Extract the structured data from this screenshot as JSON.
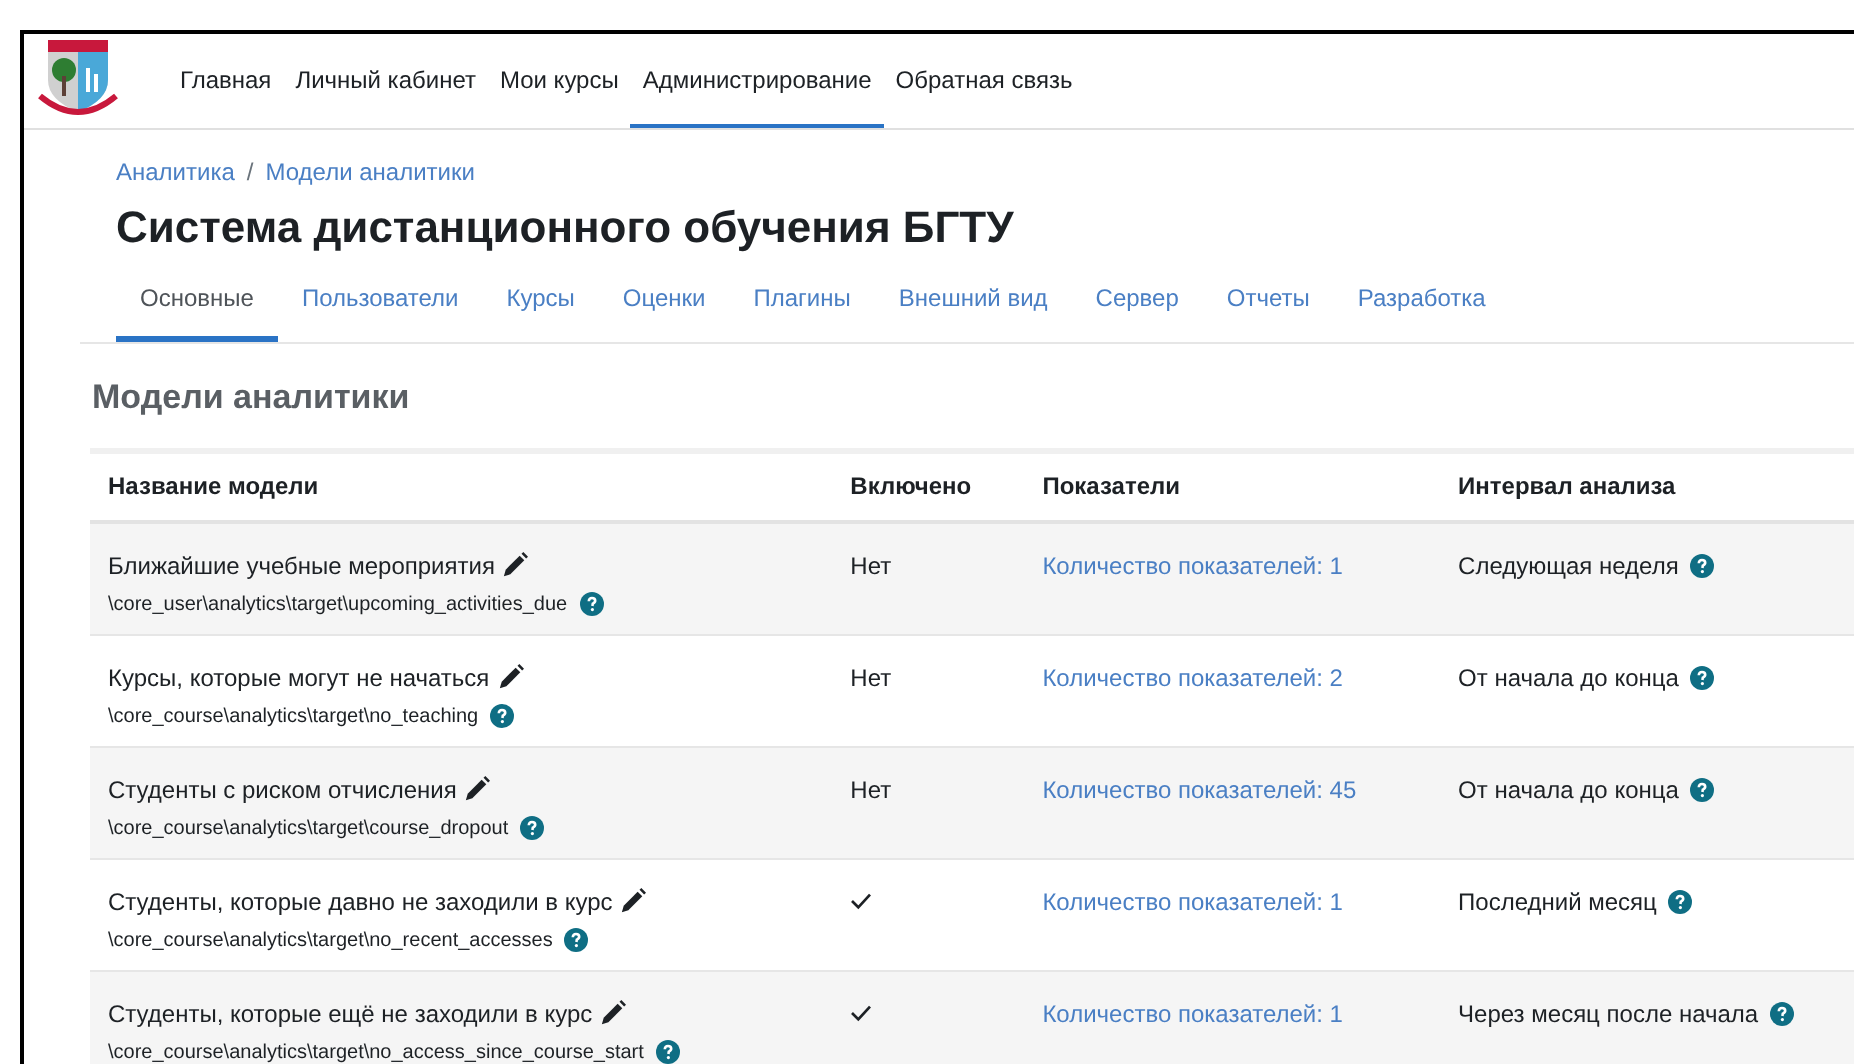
{
  "nav": [
    {
      "label": "Главная",
      "selected": false
    },
    {
      "label": "Личный кабинет",
      "selected": false
    },
    {
      "label": "Мои курсы",
      "selected": false
    },
    {
      "label": "Администрирование",
      "selected": true
    },
    {
      "label": "Обратная связь",
      "selected": false
    }
  ],
  "breadcrumb": {
    "items": [
      "Аналитика",
      "Модели аналитики"
    ],
    "separator": "/"
  },
  "title": "Система дистанционного обучения БГТУ",
  "tabs": [
    {
      "label": "Основные",
      "selected": true
    },
    {
      "label": "Пользователи",
      "selected": false
    },
    {
      "label": "Курсы",
      "selected": false
    },
    {
      "label": "Оценки",
      "selected": false
    },
    {
      "label": "Плагины",
      "selected": false
    },
    {
      "label": "Внешний вид",
      "selected": false
    },
    {
      "label": "Сервер",
      "selected": false
    },
    {
      "label": "Отчеты",
      "selected": false
    },
    {
      "label": "Разработка",
      "selected": false
    }
  ],
  "heading": "Модели аналитики",
  "table": {
    "columns": [
      "Название модели",
      "Включено",
      "Показатели",
      "Интервал анализа"
    ],
    "rows": [
      {
        "name": "Ближайшие учебные мероприятия",
        "path": "\\core_user\\analytics\\target\\upcoming_activities_due",
        "enabled": false,
        "enabled_label": "Нет",
        "indicators": "Количество показателей: 1",
        "interval": "Следующая неделя"
      },
      {
        "name": "Курсы, которые могут не начаться",
        "path": "\\core_course\\analytics\\target\\no_teaching",
        "enabled": false,
        "enabled_label": "Нет",
        "indicators": "Количество показателей: 2",
        "interval": "От начала до конца"
      },
      {
        "name": "Студенты с риском отчисления",
        "path": "\\core_course\\analytics\\target\\course_dropout",
        "enabled": false,
        "enabled_label": "Нет",
        "indicators": "Количество показателей: 45",
        "interval": "От начала до конца"
      },
      {
        "name": "Студенты, которые давно не заходили в курс",
        "path": "\\core_course\\analytics\\target\\no_recent_accesses",
        "enabled": true,
        "indicators": "Количество показателей: 1",
        "interval": "Последний месяц"
      },
      {
        "name": "Студенты, которые ещё не заходили в курс",
        "path": "\\core_course\\analytics\\target\\no_access_since_course_start",
        "enabled": true,
        "indicators": "Количество показателей: 1",
        "interval": "Через месяц после начала"
      }
    ]
  }
}
